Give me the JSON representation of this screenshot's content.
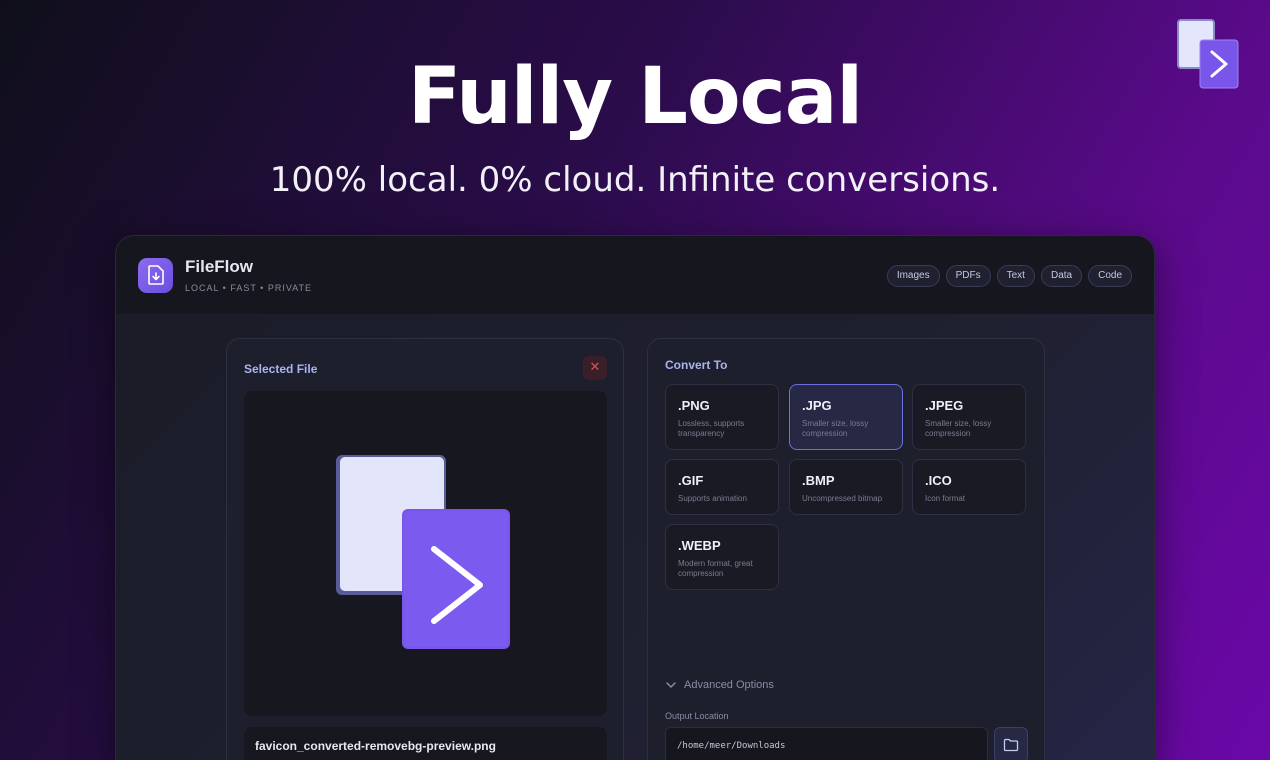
{
  "hero": {
    "title": "Fully Local",
    "subtitle": "100% local. 0% cloud. Infinite conversions."
  },
  "app": {
    "name": "FileFlow",
    "tagline": "LOCAL • FAST • PRIVATE",
    "nav": [
      "Images",
      "PDFs",
      "Text",
      "Data",
      "Code"
    ]
  },
  "selected_file": {
    "title": "Selected File",
    "close_icon": "✕",
    "file_name": "favicon_converted-removebg-preview.png"
  },
  "convert_to": {
    "title": "Convert To",
    "formats": [
      {
        "name": ".PNG",
        "desc": "Lossless, supports transparency",
        "selected": false
      },
      {
        "name": ".JPG",
        "desc": "Smaller size, lossy compression",
        "selected": true
      },
      {
        "name": ".JPEG",
        "desc": "Smaller size, lossy compression",
        "selected": false
      },
      {
        "name": ".GIF",
        "desc": "Supports animation",
        "selected": false
      },
      {
        "name": ".BMP",
        "desc": "Uncompressed bitmap",
        "selected": false
      },
      {
        "name": ".ICO",
        "desc": "Icon format",
        "selected": false
      },
      {
        "name": ".WEBP",
        "desc": "Modern format, great compression",
        "selected": false
      }
    ],
    "advanced_label": "Advanced Options",
    "output_label": "Output Location",
    "output_path": "/home/meer/Downloads"
  },
  "colors": {
    "accent": "#7b5cf0",
    "selected_border": "#6a70e0",
    "close_red": "#e0505a"
  },
  "icons": [
    "fileflow-logo-icon",
    "close-icon",
    "chevron-down-icon",
    "folder-icon",
    "file-download-icon"
  ]
}
